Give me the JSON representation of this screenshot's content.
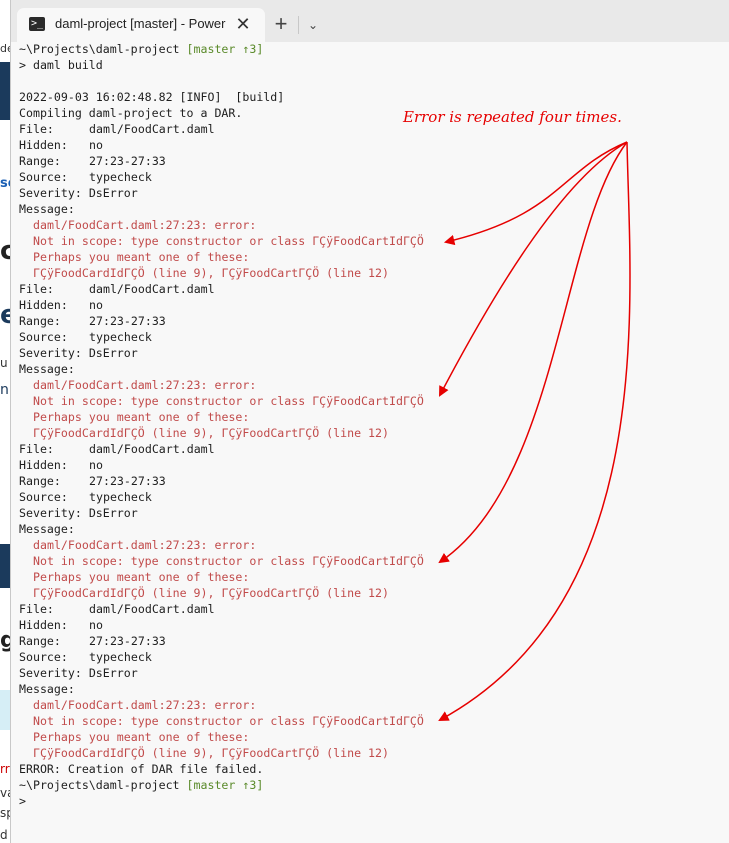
{
  "background_window": {
    "fragments": [
      "de",
      "so",
      "c",
      "e",
      "u",
      "nl",
      "g",
      "rr",
      "va",
      "sp",
      "d"
    ]
  },
  "window": {
    "tab_title": "daml-project [master] - Power",
    "close_glyph": "✕",
    "new_tab_glyph": "+",
    "dropdown_glyph": "⌄",
    "ps_glyph": ">_"
  },
  "terminal": {
    "prompt_path": "~\\Projects\\daml-project",
    "branch": "[master ↑3]",
    "command_prefix": "> ",
    "command_name": "daml",
    "command_arg": " build",
    "log_header": "2022-09-03 16:02:48.82 [INFO]  [build]",
    "compiling": "Compiling daml-project to a DAR.",
    "labels": {
      "file": "File:",
      "hidden": "Hidden:",
      "range": "Range:",
      "source": "Source:",
      "severity": "Severity:",
      "message": "Message:"
    },
    "error_block": {
      "file": "daml/FoodCart.daml",
      "hidden": "no",
      "range": "27:23-27:33",
      "source": "typecheck",
      "severity": "DsError",
      "msg1": "daml/FoodCart.daml:27:23: error:",
      "msg2": "Not in scope: type constructor or class ΓÇÿFoodCartIdΓÇÖ",
      "msg3": "Perhaps you meant one of these:",
      "msg4": "ΓÇÿFoodCardIdΓÇÖ (line 9), ΓÇÿFoodCartΓÇÖ (line 12)"
    },
    "failure": "ERROR: Creation of DAR file failed.",
    "final_prompt": ">"
  },
  "annotation": {
    "text": "Error is repeated four times.",
    "color": "#e60000"
  },
  "colors": {
    "error_text": "#c14b4b",
    "branch_text": "#5a8a2a"
  }
}
